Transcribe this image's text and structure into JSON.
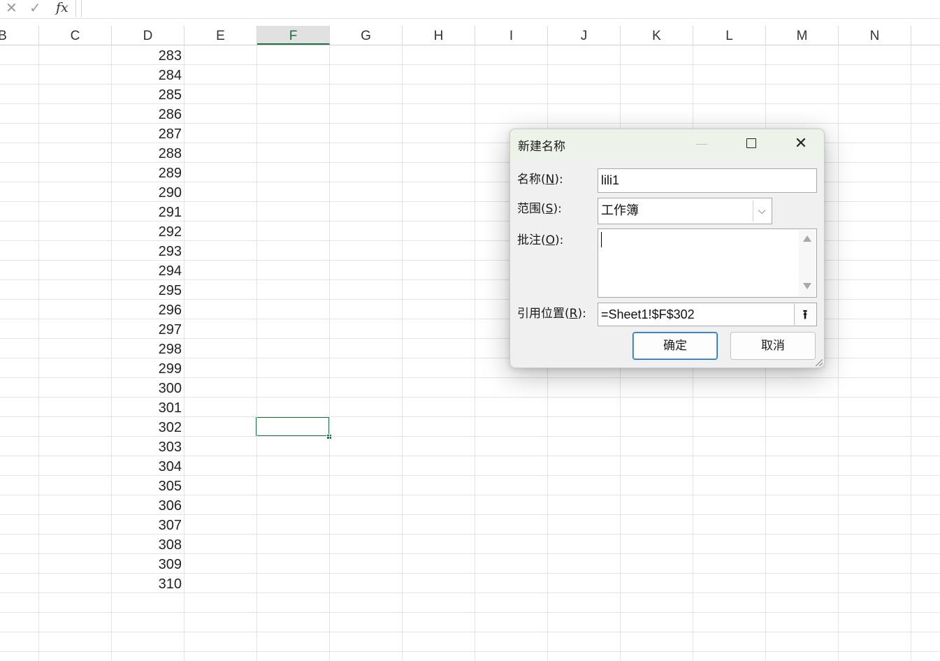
{
  "formula_bar": {
    "cancel_icon": "✕",
    "enter_icon": "✓",
    "fx_label": "fx",
    "formula": ""
  },
  "columns": [
    "B",
    "C",
    "D",
    "E",
    "F",
    "G",
    "H",
    "I",
    "J",
    "K",
    "L",
    "M",
    "N"
  ],
  "selected_column": "F",
  "column_d_values": [
    "283",
    "284",
    "285",
    "286",
    "287",
    "288",
    "289",
    "290",
    "291",
    "292",
    "293",
    "294",
    "295",
    "296",
    "297",
    "298",
    "299",
    "300",
    "301",
    "302",
    "303",
    "304",
    "305",
    "306",
    "307",
    "308",
    "309",
    "310"
  ],
  "active_cell": "F302",
  "dialog": {
    "title": "新建名称",
    "close_glyph": "✕",
    "name_label_pre": "名称(",
    "name_label_key": "N",
    "name_label_post": "):",
    "name_value": "lili1",
    "scope_label_pre": "范围(",
    "scope_label_key": "S",
    "scope_label_post": "):",
    "scope_value": "工作簿",
    "scope_arrow": "⌵",
    "comment_label_pre": "批注(",
    "comment_label_key": "O",
    "comment_label_post": "):",
    "comment_value": "",
    "ref_label_pre": "引用位置(",
    "ref_label_key": "R",
    "ref_label_post": "):",
    "ref_value": "=Sheet1!$F$302",
    "ref_button_glyph": "⭱",
    "ok_label": "确定",
    "cancel_label": "取消"
  },
  "colors": {
    "selection_green": "#217346",
    "dialog_bg": "#f0f0f0",
    "ok_border": "#1f6fbf"
  }
}
